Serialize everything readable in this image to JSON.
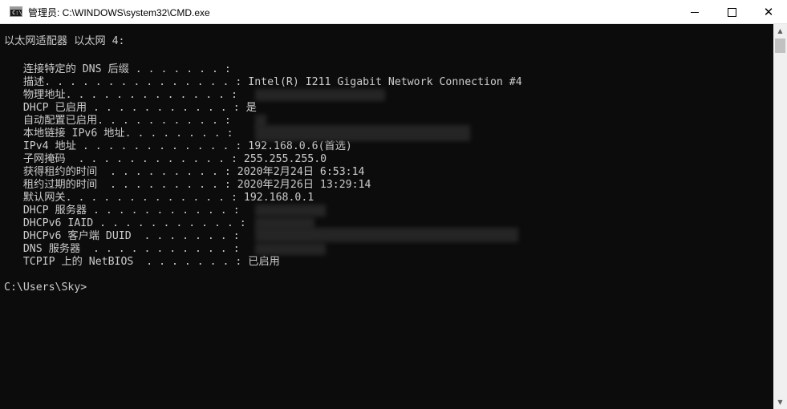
{
  "window": {
    "title": "管理员: C:\\WINDOWS\\system32\\CMD.exe",
    "icon": "cmd-icon",
    "icon_glyph": "C:\\",
    "controls": {
      "minimize": "minimize-icon",
      "maximize": "maximize-icon",
      "close": "close-icon",
      "close_glyph": "✕"
    }
  },
  "console": {
    "lines": [
      "以太网适配器 以太网 4:",
      "",
      "   连接特定的 DNS 后缀 . . . . . . . :",
      "   描述. . . . . . . . . . . . . . . : Intel(R) I211 Gigabit Network Connection #4",
      "   物理地址. . . . . . . . . . . . . :",
      "   DHCP 已启用 . . . . . . . . . . . : 是",
      "   自动配置已启用. . . . . . . . . . :",
      "   本地链接 IPv6 地址. . . . . . . . :",
      "   IPv4 地址 . . . . . . . . . . . . : 192.168.0.6(首选)",
      "   子网掩码  . . . . . . . . . . . . : 255.255.255.0",
      "   获得租约的时间  . . . . . . . . . : 2020年2月24日 6:53:14",
      "   租约过期的时间  . . . . . . . . . : 2020年2月26日 13:29:14",
      "   默认网关. . . . . . . . . . . . . : 192.168.0.1",
      "   DHCP 服务器 . . . . . . . . . . . :",
      "   DHCPv6 IAID . . . . . . . . . . . :",
      "   DHCPv6 客户端 DUID  . . . . . . . :",
      "   DNS 服务器  . . . . . . . . . . . :",
      "   TCPIP 上的 NetBIOS  . . . . . . . : 已启用",
      "",
      "C:\\Users\\Sky>"
    ]
  },
  "scrollbar": {
    "up_glyph": "▲",
    "down_glyph": "▼"
  },
  "colors": {
    "console_bg": "#0c0c0c",
    "console_text": "#cccccc",
    "titlebar_bg": "#ffffff"
  }
}
